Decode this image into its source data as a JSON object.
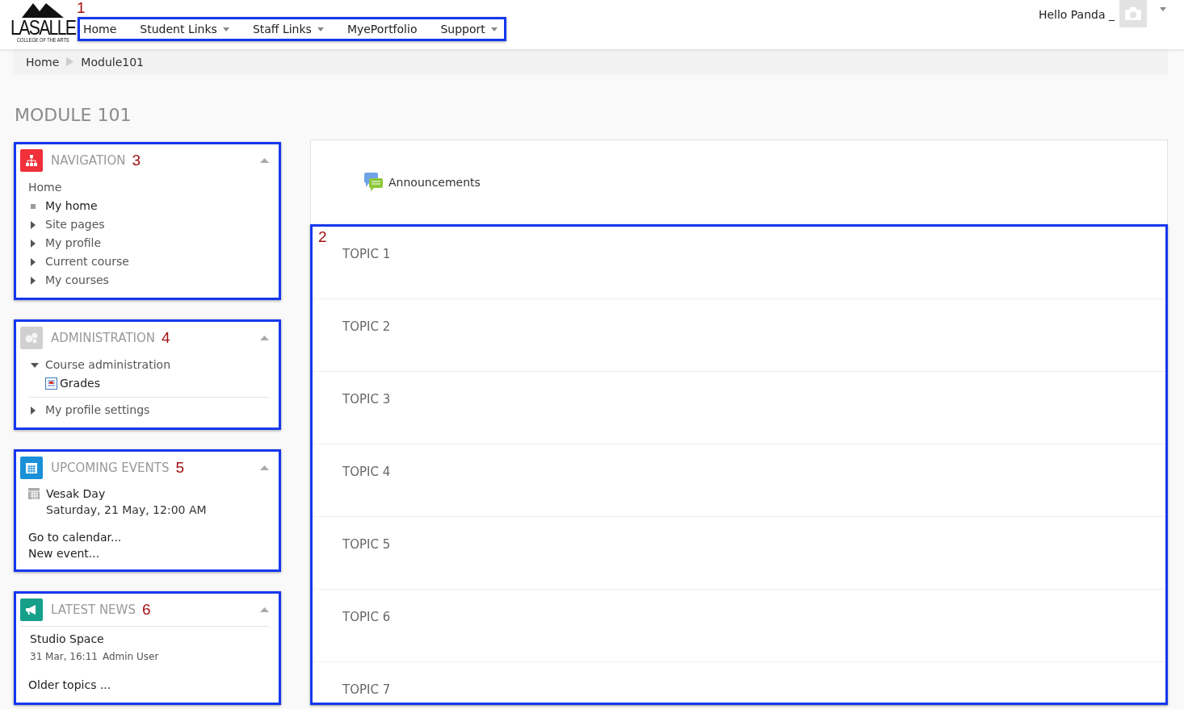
{
  "header": {
    "logo": {
      "name": "LASALLE",
      "subtitle": "COLLEGE OF THE ARTS"
    },
    "callout": "1",
    "menu": [
      {
        "label": "Home",
        "dropdown": false
      },
      {
        "label": "Student Links",
        "dropdown": true
      },
      {
        "label": "Staff Links",
        "dropdown": true
      },
      {
        "label": "MyePortfolio",
        "dropdown": false
      },
      {
        "label": "Support",
        "dropdown": true
      }
    ],
    "user": {
      "greeting": "Hello Panda _"
    }
  },
  "breadcrumb": [
    "Home",
    "Module101"
  ],
  "page_title": "MODULE 101",
  "blocks": [
    {
      "kind": "navigation",
      "title": "NAVIGATION",
      "callout": "3",
      "root": "Home",
      "items": [
        {
          "label": "My home",
          "kind": "leaf"
        },
        {
          "label": "Site pages",
          "kind": "branch",
          "expanded": false
        },
        {
          "label": "My profile",
          "kind": "branch",
          "expanded": false
        },
        {
          "label": "Current course",
          "kind": "branch",
          "expanded": false
        },
        {
          "label": "My courses",
          "kind": "branch",
          "expanded": false
        }
      ]
    },
    {
      "kind": "administration",
      "title": "ADMINISTRATION",
      "callout": "4",
      "items": [
        {
          "label": "Course administration",
          "kind": "branch",
          "expanded": true,
          "children": [
            {
              "label": "Grades",
              "kind": "grades"
            }
          ]
        },
        {
          "label": "My profile settings",
          "kind": "branch",
          "expanded": false
        }
      ]
    },
    {
      "kind": "events",
      "title": "UPCOMING EVENTS",
      "callout": "5",
      "event": {
        "name": "Vesak Day",
        "date": "Saturday, 21 May, 12:00 AM"
      },
      "links": [
        "Go to calendar...",
        "New event..."
      ]
    },
    {
      "kind": "news",
      "title": "LATEST NEWS",
      "callout": "6",
      "post": {
        "title": "Studio Space",
        "date": "31 Mar, 16:11",
        "author": "Admin User"
      },
      "links": [
        "Older topics ..."
      ]
    }
  ],
  "main": {
    "announcements": "Announcements",
    "callout": "2",
    "topics": [
      "TOPIC 1",
      "TOPIC 2",
      "TOPIC 3",
      "TOPIC 4",
      "TOPIC 5",
      "TOPIC 6",
      "TOPIC 7"
    ]
  }
}
